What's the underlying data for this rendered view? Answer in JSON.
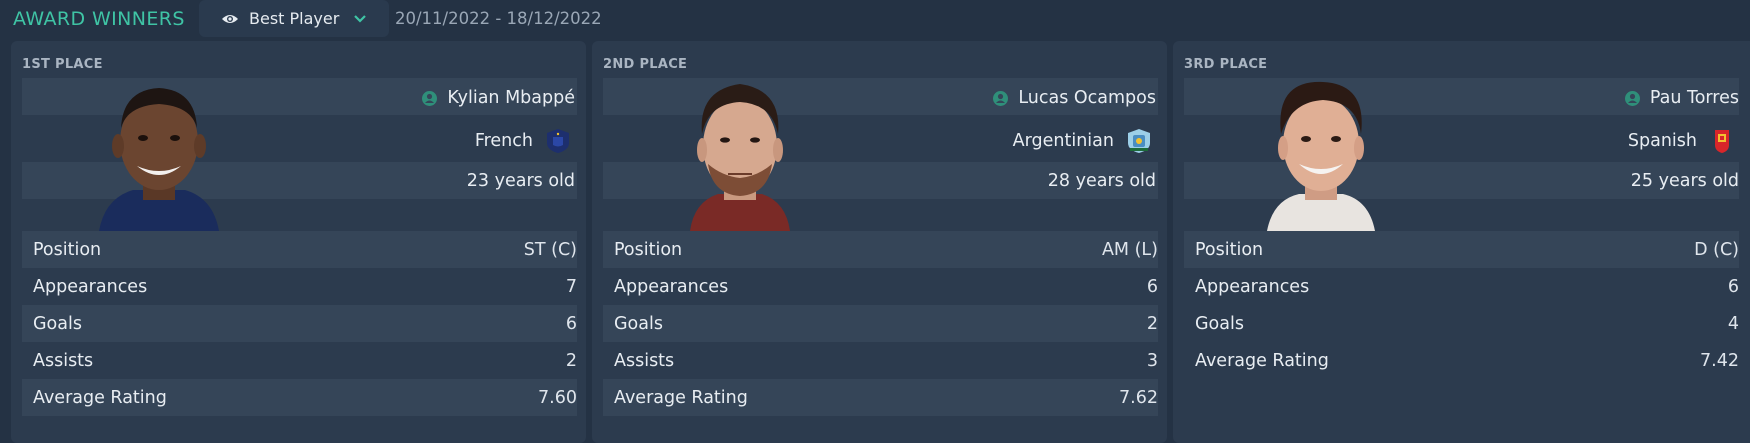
{
  "header": {
    "title": "AWARD WINNERS",
    "award_selector": "Best Player",
    "date_range": "20/11/2022 - 18/12/2022"
  },
  "colors": {
    "accent": "#3fc4a5",
    "panel": "#2c3b4e",
    "stripe": "#354558"
  },
  "winners": [
    {
      "place": "1ST PLACE",
      "name": "Kylian Mbappé",
      "nationality": "French",
      "flag_icon": "france-federation-icon",
      "age": "23 years old",
      "stats": [
        {
          "label": "Position",
          "value": "ST (C)"
        },
        {
          "label": "Appearances",
          "value": "7"
        },
        {
          "label": "Goals",
          "value": "6"
        },
        {
          "label": "Assists",
          "value": "2"
        },
        {
          "label": "Average Rating",
          "value": "7.60"
        }
      ]
    },
    {
      "place": "2ND PLACE",
      "name": "Lucas Ocampos",
      "nationality": "Argentinian",
      "flag_icon": "argentina-federation-icon",
      "age": "28 years old",
      "stats": [
        {
          "label": "Position",
          "value": "AM (L)"
        },
        {
          "label": "Appearances",
          "value": "6"
        },
        {
          "label": "Goals",
          "value": "2"
        },
        {
          "label": "Assists",
          "value": "3"
        },
        {
          "label": "Average Rating",
          "value": "7.62"
        }
      ]
    },
    {
      "place": "3RD PLACE",
      "name": "Pau Torres",
      "nationality": "Spanish",
      "flag_icon": "spain-federation-icon",
      "age": "25 years old",
      "stats": [
        {
          "label": "Position",
          "value": "D (C)"
        },
        {
          "label": "Appearances",
          "value": "6"
        },
        {
          "label": "Goals",
          "value": "4"
        },
        {
          "label": "Average Rating",
          "value": "7.42"
        }
      ]
    }
  ]
}
